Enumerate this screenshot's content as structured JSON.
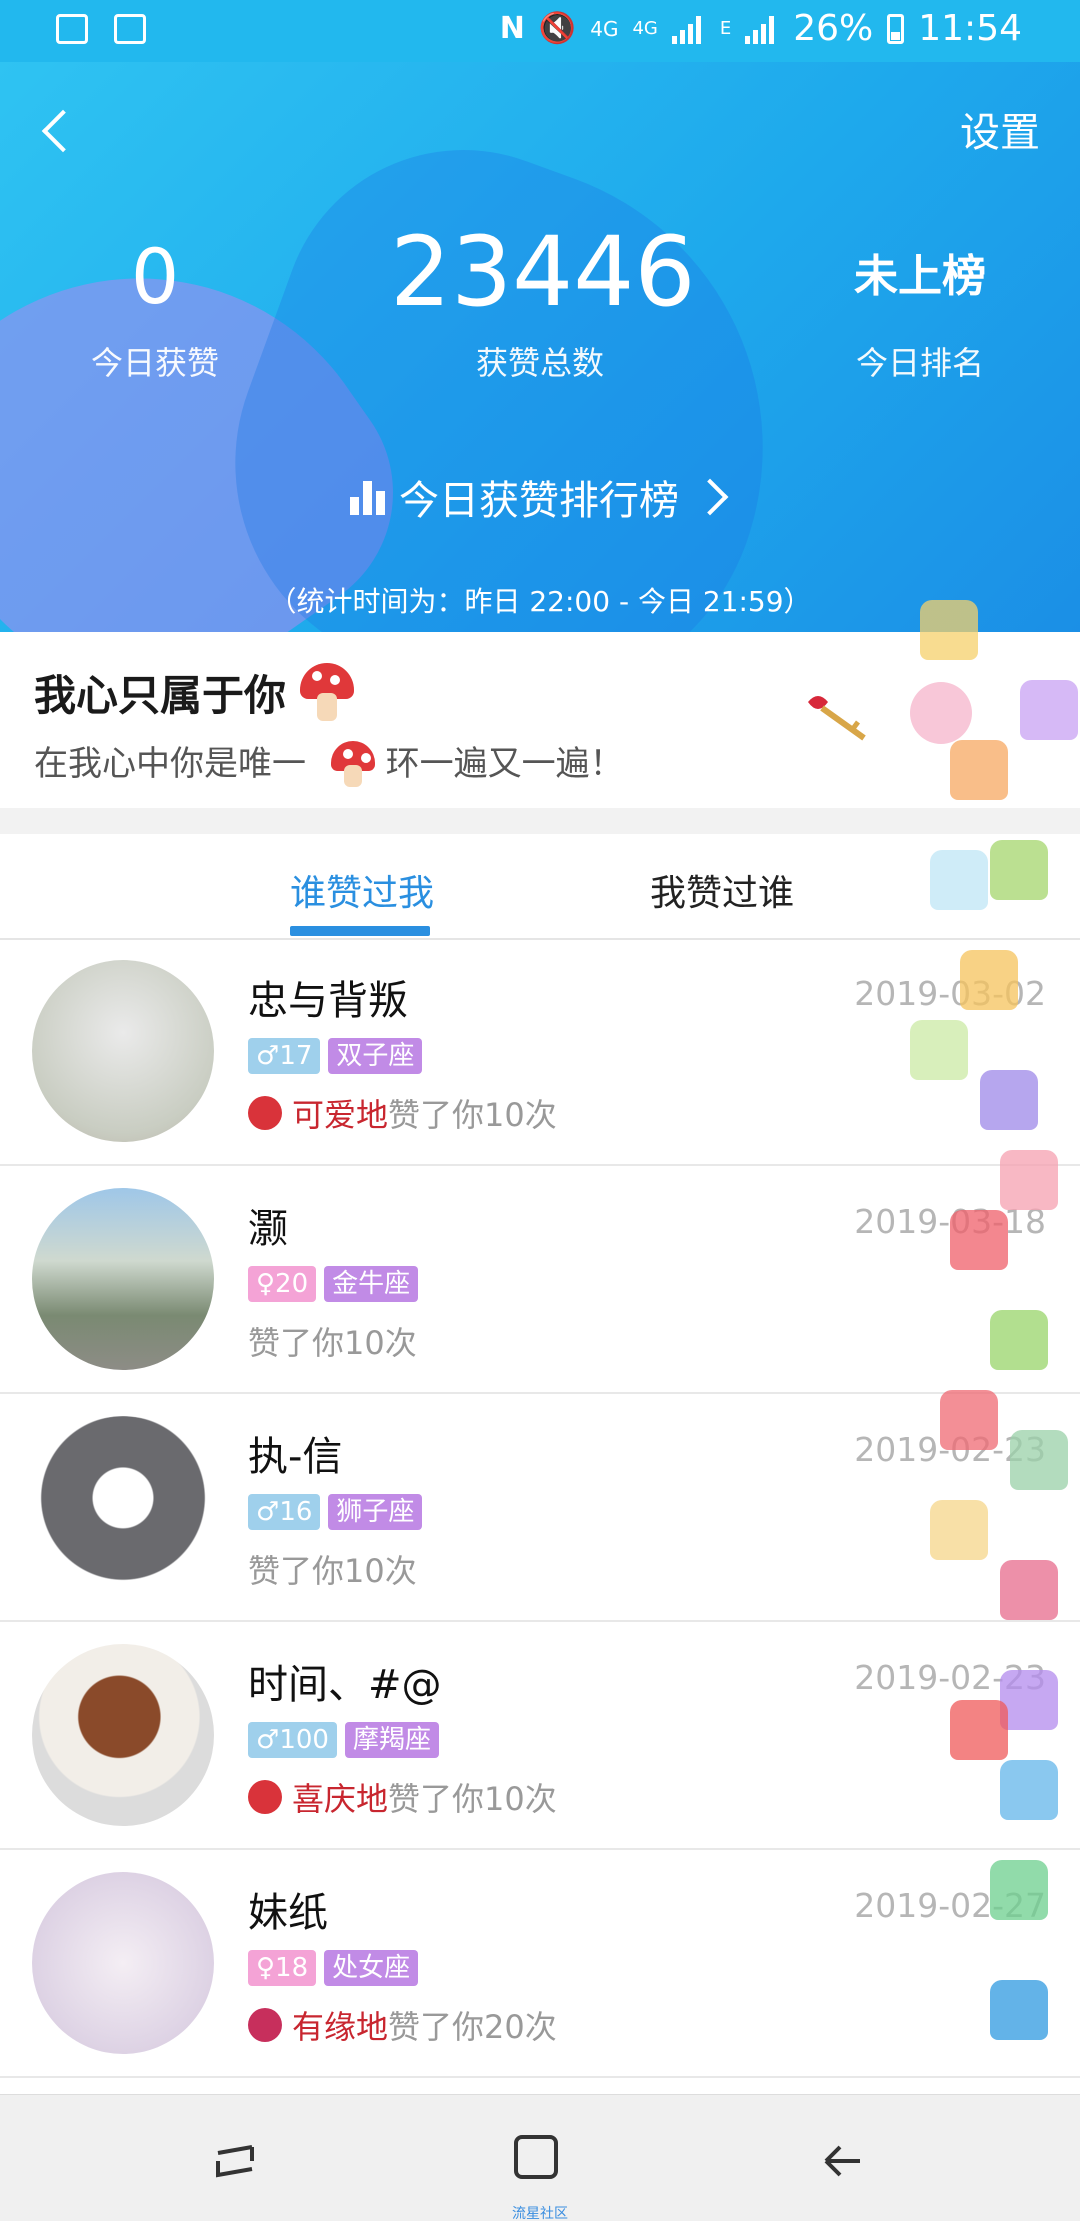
{
  "status_bar": {
    "battery": "26%",
    "time": "11:54",
    "network_1": "4G",
    "network_2": "4G",
    "network_3": "E"
  },
  "header": {
    "settings_label": "设置",
    "today_likes_value": "0",
    "today_likes_label": "今日获赞",
    "total_likes_value": "23446",
    "total_likes_label": "获赞总数",
    "today_rank_value": "未上榜",
    "today_rank_label": "今日排名",
    "leaderboard_link": "今日获赞排行榜",
    "stat_time": "（统计时间为：昨日 22:00 - 今日 21:59）",
    "accent": "#22b8ee"
  },
  "signature": {
    "title": "我心只属于你",
    "subtitle": "在我心中你是唯一",
    "subtitle_tail": "环一遍又一遍！"
  },
  "tabs": {
    "tab1": "谁赞过我",
    "tab2": "我赞过谁",
    "active_color": "#2a8fe0"
  },
  "list": [
    {
      "name": "忠与背叛",
      "date": "2019-03-02",
      "gender": "♂",
      "age": "17",
      "zodiac": "双子座",
      "adverb": "可爱地",
      "likes": "赞了你10次"
    },
    {
      "name": "灏",
      "date": "2019-03-18",
      "gender": "♀",
      "age": "20",
      "zodiac": "金牛座",
      "adverb": "",
      "likes": "赞了你10次"
    },
    {
      "name": "执-信",
      "date": "2019-02-23",
      "gender": "♂",
      "age": "16",
      "zodiac": "狮子座",
      "adverb": "",
      "likes": "赞了你10次"
    },
    {
      "name": "时间、#@",
      "date": "2019-02-23",
      "gender": "♂",
      "age": "100",
      "zodiac": "摩羯座",
      "adverb": "喜庆地",
      "likes": "赞了你10次"
    },
    {
      "name": "妹纸",
      "date": "2019-02-27",
      "gender": "♀",
      "age": "18",
      "zodiac": "处女座",
      "adverb": "有缘地",
      "likes": "赞了你20次"
    }
  ],
  "navbar": {
    "caption": "流星社区"
  }
}
